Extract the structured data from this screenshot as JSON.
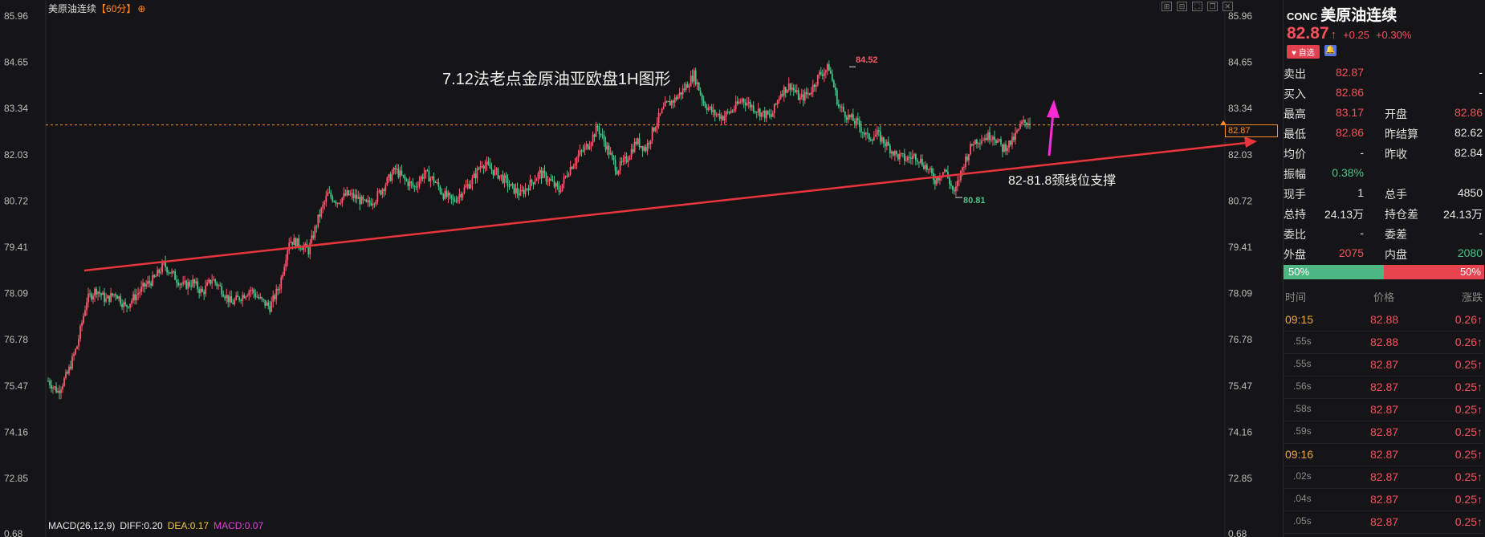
{
  "chart": {
    "symbol_name": "美原油连续",
    "period": "【60分】",
    "control_glyph": "⊕",
    "y_ticks": [
      "85.96",
      "84.65",
      "83.34",
      "82.03",
      "80.72",
      "79.41",
      "78.09",
      "76.78",
      "75.47",
      "74.16",
      "72.85",
      "0.68"
    ],
    "annotation_title": "7.12法老点金原油亚欧盘1H图形",
    "annotation_support": "82-81.8颈线位支撑",
    "high_label": "84.52",
    "low_label": "80.81",
    "current_price_tag": "82.87",
    "macd": {
      "name": "MACD(26,12,9)",
      "diff": "DIFF:0.20",
      "dea": "DEA:0.17",
      "macd": "MACD:0.07"
    },
    "colors": {
      "up": "#f15b6c",
      "down": "#4ec18a",
      "trendline": "#e8343c",
      "arrow": "#ff2bd6",
      "price_line": "#ff8a2a"
    }
  },
  "chart_data": {
    "type": "candlestick",
    "title": "7.12法老点金原油亚欧盘1H图形",
    "ylim": [
      72.2,
      86.3
    ],
    "path_close": [
      75.6,
      75.3,
      75.8,
      76.6,
      77.9,
      78.2,
      77.9,
      78.1,
      77.7,
      78.0,
      78.3,
      78.5,
      78.9,
      78.6,
      78.3,
      78.4,
      78.1,
      78.5,
      78.2,
      77.8,
      78.0,
      78.2,
      77.9,
      77.7,
      78.3,
      79.6,
      79.5,
      79.3,
      80.2,
      80.9,
      80.7,
      80.9,
      80.8,
      80.6,
      80.8,
      81.2,
      81.6,
      81.3,
      81.1,
      81.5,
      81.3,
      80.9,
      80.7,
      81.0,
      81.3,
      81.8,
      81.6,
      81.4,
      81.1,
      80.9,
      81.2,
      81.5,
      81.3,
      81.0,
      81.6,
      82.0,
      82.3,
      82.8,
      82.2,
      81.6,
      81.9,
      82.4,
      82.2,
      82.9,
      83.4,
      83.6,
      83.9,
      84.3,
      83.5,
      83.2,
      83.1,
      83.3,
      83.6,
      83.4,
      83.2,
      83.1,
      83.8,
      84.0,
      83.6,
      83.8,
      84.3,
      84.5,
      83.4,
      83.1,
      82.9,
      82.5,
      82.6,
      82.3,
      82.0,
      81.9,
      82.0,
      81.7,
      81.3,
      81.6,
      80.9,
      81.8,
      82.4,
      82.5,
      82.6,
      82.2,
      82.4,
      82.9,
      83.0
    ],
    "high": 84.52,
    "low": 80.81,
    "current": 82.87
  },
  "panel": {
    "code": "CONC",
    "name": "美原油连续",
    "price": "82.87",
    "up_arrow": "↑",
    "change": "+0.25",
    "change_pct": "+0.30%",
    "fav_label": "♥ 自选",
    "bell_icon": "🔔",
    "rows": [
      {
        "k": "卖出",
        "v": "82.87",
        "vc": "red",
        "k2": "",
        "v2": "-",
        "v2c": "white"
      },
      {
        "k": "买入",
        "v": "82.86",
        "vc": "red",
        "k2": "",
        "v2": "-",
        "v2c": "white"
      },
      {
        "k": "最高",
        "v": "83.17",
        "vc": "red",
        "k2": "开盘",
        "v2": "82.86",
        "v2c": "red"
      },
      {
        "k": "最低",
        "v": "82.86",
        "vc": "red",
        "k2": "昨结算",
        "v2": "82.62",
        "v2c": "white"
      },
      {
        "k": "均价",
        "v": "-",
        "vc": "white",
        "k2": "昨收",
        "v2": "82.84",
        "v2c": "white"
      },
      {
        "k": "振幅",
        "v": "0.38%",
        "vc": "green",
        "k2": "",
        "v2": "",
        "v2c": "white"
      },
      {
        "k": "现手",
        "v": "1",
        "vc": "white",
        "k2": "总手",
        "v2": "4850",
        "v2c": "white"
      },
      {
        "k": "总持",
        "v": "24.13万",
        "vc": "white",
        "k2": "持仓差",
        "v2": "24.13万",
        "v2c": "white"
      },
      {
        "k": "委比",
        "v": "-",
        "vc": "white",
        "k2": "委差",
        "v2": "-",
        "v2c": "white"
      },
      {
        "k": "外盘",
        "v": "2075",
        "vc": "red",
        "k2": "内盘",
        "v2": "2080",
        "v2c": "green"
      }
    ],
    "ratio_left": "50%",
    "ratio_right": "50%",
    "ticks_header": {
      "time": "时间",
      "price": "价格",
      "change": "涨跌"
    },
    "ticks": [
      {
        "t": "09:15",
        "p": "82.88",
        "c": "0.26↑",
        "hr": true
      },
      {
        "t": ".55s",
        "p": "82.88",
        "c": "0.26↑",
        "hr": false
      },
      {
        "t": ".55s",
        "p": "82.87",
        "c": "0.25↑",
        "hr": false
      },
      {
        "t": ".56s",
        "p": "82.87",
        "c": "0.25↑",
        "hr": false
      },
      {
        "t": ".58s",
        "p": "82.87",
        "c": "0.25↑",
        "hr": false
      },
      {
        "t": ".59s",
        "p": "82.87",
        "c": "0.25↑",
        "hr": false
      },
      {
        "t": "09:16",
        "p": "82.87",
        "c": "0.25↑",
        "hr": true
      },
      {
        "t": ".02s",
        "p": "82.87",
        "c": "0.25↑",
        "hr": false
      },
      {
        "t": ".04s",
        "p": "82.87",
        "c": "0.25↑",
        "hr": false
      },
      {
        "t": ".05s",
        "p": "82.87",
        "c": "0.25↑",
        "hr": false
      }
    ]
  }
}
